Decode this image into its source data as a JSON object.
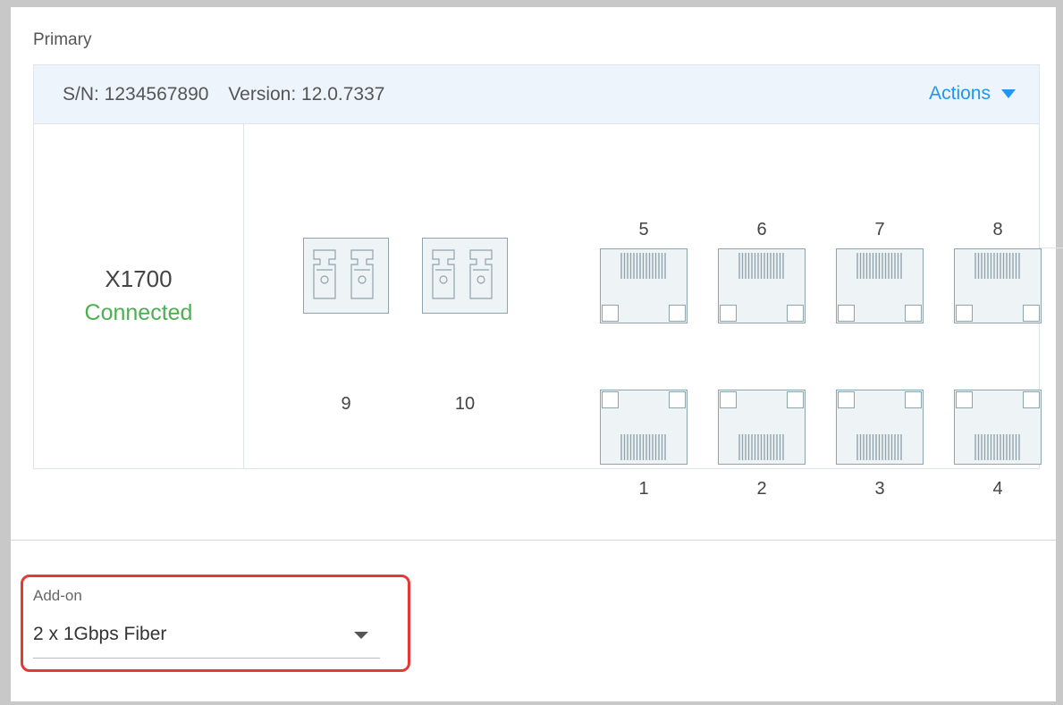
{
  "section": {
    "label": "Primary"
  },
  "device": {
    "serial_label": "S/N: 1234567890",
    "version_label": "Version: 12.0.7337",
    "actions_label": "Actions",
    "model": "X1700",
    "status": "Connected",
    "status_color": "#4caf50"
  },
  "ports": {
    "top_row": [
      "5",
      "6",
      "7",
      "8"
    ],
    "bottom_row": [
      "1",
      "2",
      "3",
      "4"
    ],
    "sfp": [
      "9",
      "10"
    ]
  },
  "addon": {
    "label": "Add-on",
    "value": "2 x 1Gbps Fiber"
  },
  "colors": {
    "accent": "#2196f3",
    "highlight": "#e53935",
    "header_bg": "#edf4fb"
  }
}
